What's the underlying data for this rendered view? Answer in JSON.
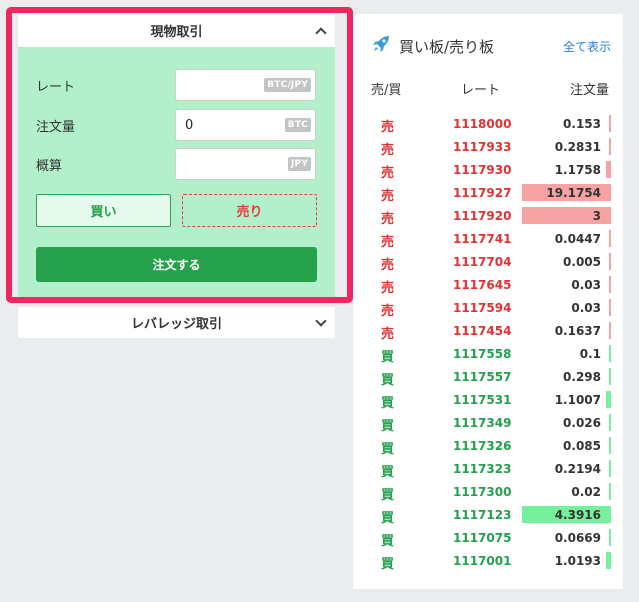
{
  "spot": {
    "title": "現物取引",
    "rate_label": "レート",
    "rate_value": "",
    "rate_unit": "BTC/JPY",
    "amount_label": "注文量",
    "amount_value": "0",
    "amount_unit": "BTC",
    "estimate_label": "概算",
    "estimate_value": "",
    "estimate_unit": "JPY",
    "buy_label": "買い",
    "sell_label": "売り",
    "order_label": "注文する"
  },
  "leverage": {
    "title": "レバレッジ取引"
  },
  "orderbook": {
    "title": "買い板/売り板",
    "show_all": "全て表示",
    "col_side": "売/買",
    "col_rate": "レート",
    "col_qty": "注文量",
    "rows": [
      {
        "side": "売",
        "type": "sell",
        "rate": "1118000",
        "qty": "0.153",
        "depth": 0.008
      },
      {
        "side": "売",
        "type": "sell",
        "rate": "1117933",
        "qty": "0.2831",
        "depth": 0.015
      },
      {
        "side": "売",
        "type": "sell",
        "rate": "1117930",
        "qty": "1.1758",
        "depth": 0.061
      },
      {
        "side": "売",
        "type": "sell",
        "rate": "1117927",
        "qty": "19.1754",
        "depth": 1.0
      },
      {
        "side": "売",
        "type": "sell",
        "rate": "1117920",
        "qty": "3",
        "depth": 1.0
      },
      {
        "side": "売",
        "type": "sell",
        "rate": "1117741",
        "qty": "0.0447",
        "depth": 0.003
      },
      {
        "side": "売",
        "type": "sell",
        "rate": "1117704",
        "qty": "0.005",
        "depth": 0.003
      },
      {
        "side": "売",
        "type": "sell",
        "rate": "1117645",
        "qty": "0.03",
        "depth": 0.003
      },
      {
        "side": "売",
        "type": "sell",
        "rate": "1117594",
        "qty": "0.03",
        "depth": 0.003
      },
      {
        "side": "売",
        "type": "sell",
        "rate": "1117454",
        "qty": "0.1637",
        "depth": 0.009
      },
      {
        "side": "買",
        "type": "buy",
        "rate": "1117558",
        "qty": "0.1",
        "depth": 0.005
      },
      {
        "side": "買",
        "type": "buy",
        "rate": "1117557",
        "qty": "0.298",
        "depth": 0.016
      },
      {
        "side": "買",
        "type": "buy",
        "rate": "1117531",
        "qty": "1.1007",
        "depth": 0.057
      },
      {
        "side": "買",
        "type": "buy",
        "rate": "1117349",
        "qty": "0.026",
        "depth": 0.003
      },
      {
        "side": "買",
        "type": "buy",
        "rate": "1117326",
        "qty": "0.085",
        "depth": 0.005
      },
      {
        "side": "買",
        "type": "buy",
        "rate": "1117323",
        "qty": "0.2194",
        "depth": 0.012
      },
      {
        "side": "買",
        "type": "buy",
        "rate": "1117300",
        "qty": "0.02",
        "depth": 0.003
      },
      {
        "side": "買",
        "type": "buy",
        "rate": "1117123",
        "qty": "4.3916",
        "depth": 1.0
      },
      {
        "side": "買",
        "type": "buy",
        "rate": "1117075",
        "qty": "0.0669",
        "depth": 0.004
      },
      {
        "side": "買",
        "type": "buy",
        "rate": "1117001",
        "qty": "1.0193",
        "depth": 0.053
      }
    ]
  },
  "colors": {
    "sell": "#df3232",
    "buy": "#23a04c",
    "highlight": "#f22561",
    "panel_green": "#b1f0cb"
  },
  "icons": {
    "spot_collapse": "chevron-up-icon",
    "leverage_expand": "chevron-down-icon",
    "orderbook": "rocket-icon"
  }
}
